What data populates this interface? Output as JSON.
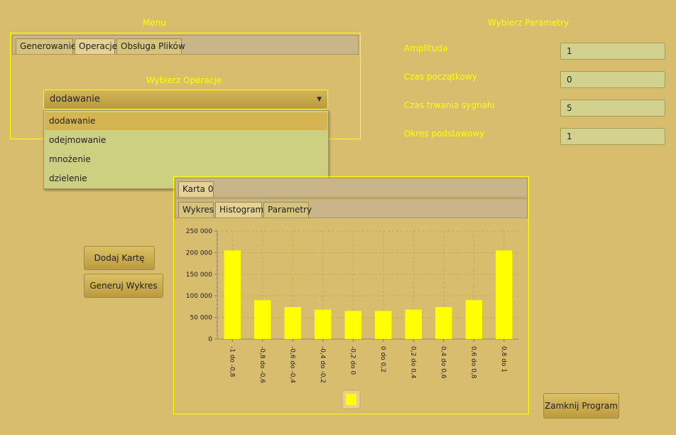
{
  "menu": {
    "title": "Menu",
    "tabs": [
      "Generowanie",
      "Operacje",
      "Obsługa Plików"
    ],
    "selected_tab": "Operacje",
    "operation_label": "Wybierz Operacje",
    "combo_value": "dodawanie",
    "options": [
      "dodawanie",
      "odejmowanie",
      "mnożenie",
      "dzielenie"
    ]
  },
  "params": {
    "title": "Wybierz Parametry",
    "fields": [
      {
        "label": "Amplituda",
        "value": "1"
      },
      {
        "label": "Czas początkowy",
        "value": "0"
      },
      {
        "label": "Czas trwania sygnału",
        "value": "5"
      },
      {
        "label": "Okres podstawowy",
        "value": "1"
      }
    ]
  },
  "buttons": {
    "add_card": "Dodaj Kartę",
    "generate_chart": "Generuj Wykres",
    "close_program": "Zamknij Program"
  },
  "cards": {
    "tab": "Karta 0",
    "inner_tabs": [
      "Wykres",
      "Histogram",
      "Parametry"
    ],
    "selected_inner": "Histogram"
  },
  "colors": {
    "background": "#d9bd6e",
    "accent": "#ffff00",
    "bar": "#ffff00"
  },
  "chart_data": {
    "type": "bar",
    "categories": [
      "-1 do -0,8",
      "-0,8 do -0,6",
      "-0,6 do -0,4",
      "-0,4 do -0,2",
      "-0,2 do 0",
      "0 do 0,2",
      "0,2 do 0,4",
      "0,4 do 0,6",
      "0,6 do 0,8",
      "0,8 do 1"
    ],
    "values": [
      205000,
      90000,
      74000,
      68000,
      65000,
      65000,
      68000,
      74000,
      90000,
      205000
    ],
    "yticks": [
      "0",
      "50 000",
      "100 000",
      "150 000",
      "200 000",
      "250 000"
    ],
    "ylim": [
      0,
      250000
    ],
    "grid": true,
    "legend_placement": "bottom"
  }
}
